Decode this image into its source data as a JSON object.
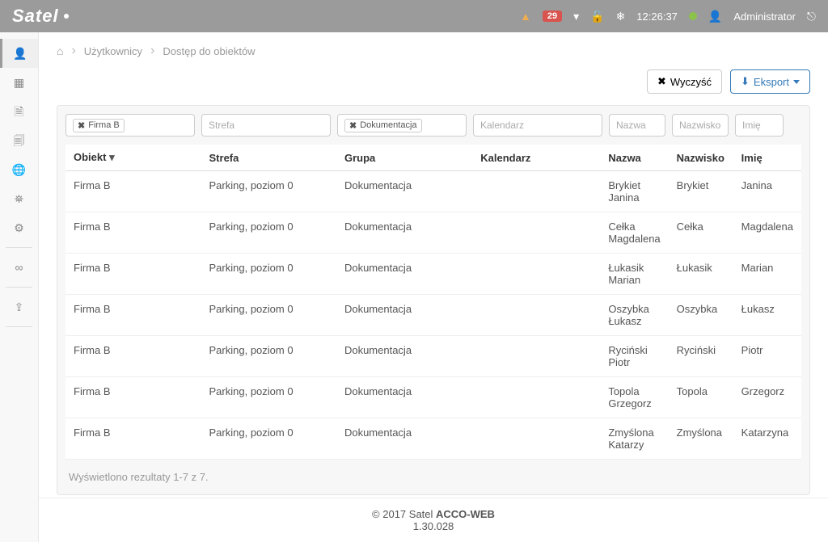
{
  "brand": "Satel",
  "topbar": {
    "alerts_count": "29",
    "time": "12:26:37",
    "user_label": "Administrator"
  },
  "breadcrumbs": {
    "level1": "Użytkownicy",
    "level2": "Dostęp do obiektów"
  },
  "actions": {
    "clear": "Wyczyść",
    "export": "Eksport"
  },
  "filters": {
    "obiekt_tag": "Firma B",
    "strefa_placeholder": "Strefa",
    "grupa_tag": "Dokumentacja",
    "kalendarz_placeholder": "Kalendarz",
    "nazwa_placeholder": "Nazwa",
    "nazwisko_placeholder": "Nazwisko",
    "imie_placeholder": "Imię"
  },
  "table": {
    "headers": {
      "obiekt": "Obiekt",
      "strefa": "Strefa",
      "grupa": "Grupa",
      "kalendarz": "Kalendarz",
      "nazwa": "Nazwa",
      "nazwisko": "Nazwisko",
      "imie": "Imię"
    },
    "rows": [
      {
        "obiekt": "Firma B",
        "strefa": "Parking, poziom 0",
        "grupa": "Dokumentacja",
        "kalendarz": "",
        "nazwa": "Brykiet Janina",
        "nazwisko": "Brykiet",
        "imie": "Janina"
      },
      {
        "obiekt": "Firma B",
        "strefa": "Parking, poziom 0",
        "grupa": "Dokumentacja",
        "kalendarz": "",
        "nazwa": "Cełka Magdalena",
        "nazwisko": "Cełka",
        "imie": "Magdalena"
      },
      {
        "obiekt": "Firma B",
        "strefa": "Parking, poziom 0",
        "grupa": "Dokumentacja",
        "kalendarz": "",
        "nazwa": "Łukasik Marian",
        "nazwisko": "Łukasik",
        "imie": "Marian"
      },
      {
        "obiekt": "Firma B",
        "strefa": "Parking, poziom 0",
        "grupa": "Dokumentacja",
        "kalendarz": "",
        "nazwa": "Oszybka Łukasz",
        "nazwisko": "Oszybka",
        "imie": "Łukasz"
      },
      {
        "obiekt": "Firma B",
        "strefa": "Parking, poziom 0",
        "grupa": "Dokumentacja",
        "kalendarz": "",
        "nazwa": "Ryciński Piotr",
        "nazwisko": "Ryciński",
        "imie": "Piotr"
      },
      {
        "obiekt": "Firma B",
        "strefa": "Parking, poziom 0",
        "grupa": "Dokumentacja",
        "kalendarz": "",
        "nazwa": "Topola Grzegorz",
        "nazwisko": "Topola",
        "imie": "Grzegorz"
      },
      {
        "obiekt": "Firma B",
        "strefa": "Parking, poziom 0",
        "grupa": "Dokumentacja",
        "kalendarz": "",
        "nazwa": "Zmyślona Katarzy",
        "nazwisko": "Zmyślona",
        "imie": "Katarzyna"
      }
    ],
    "results_info": "Wyświetlono rezultaty 1-7 z 7."
  },
  "footer": {
    "copyright": "© 2017 Satel ",
    "product": "ACCO-WEB",
    "version": "1.30.028"
  }
}
